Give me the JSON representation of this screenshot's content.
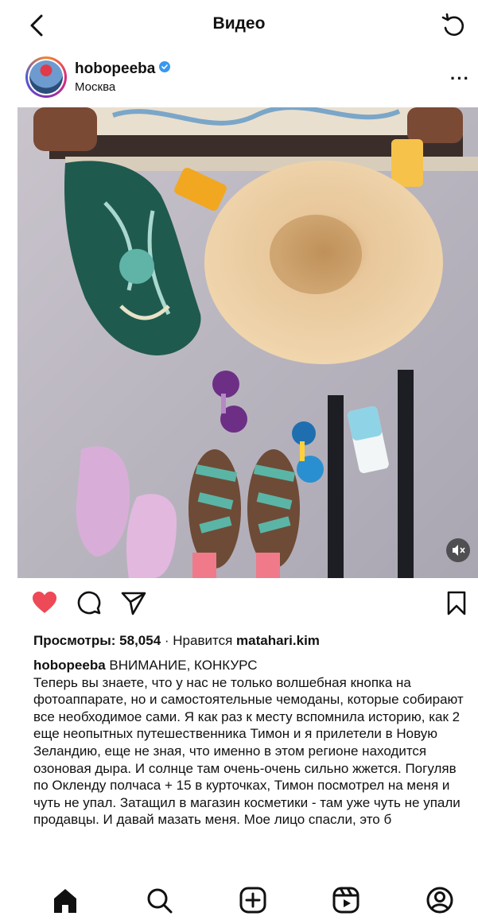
{
  "topbar": {
    "title": "Видео"
  },
  "post": {
    "username": "hobopeeba",
    "location": "Москва",
    "views_label": "Просмотры:",
    "views_count": "58,054",
    "likes_prefix": "· Нравится",
    "liked_by": "matahari.kim",
    "caption_username": "hobopeeba",
    "caption_text": "ВНИМАНИЕ, КОНКУРС\nТеперь вы знаете, что у нас не только волшебная кнопка на фотоаппарате, но и самостоятельные чемоданы, которые собирают все необходимое сами. Я как раз к месту вспомнила историю, как 2 еще неопытных путешественника Тимон и я прилетели в Новую Зеландию, еще не зная, что именно в этом регионе находится озоновая дыра. И солнце там очень-очень сильно жжется. Погуляв по Окленду полчаса + 15 в курточках, Тимон посмотрел на меня и чуть не упал. Затащил в магазин косметики - там уже чуть не упали продавцы. И давай мазать меня. Мое лицо спасли, это б"
  },
  "colors": {
    "like": "#ed4956",
    "verified": "#3897f0"
  },
  "icons": {
    "back": "chevron-left-icon",
    "reload": "refresh-icon",
    "more": "more-horizontal-icon",
    "like": "heart-icon",
    "comment": "comment-icon",
    "share": "send-icon",
    "save": "bookmark-icon",
    "nav": [
      "home-icon",
      "search-icon",
      "add-post-icon",
      "reels-icon",
      "profile-icon"
    ]
  }
}
